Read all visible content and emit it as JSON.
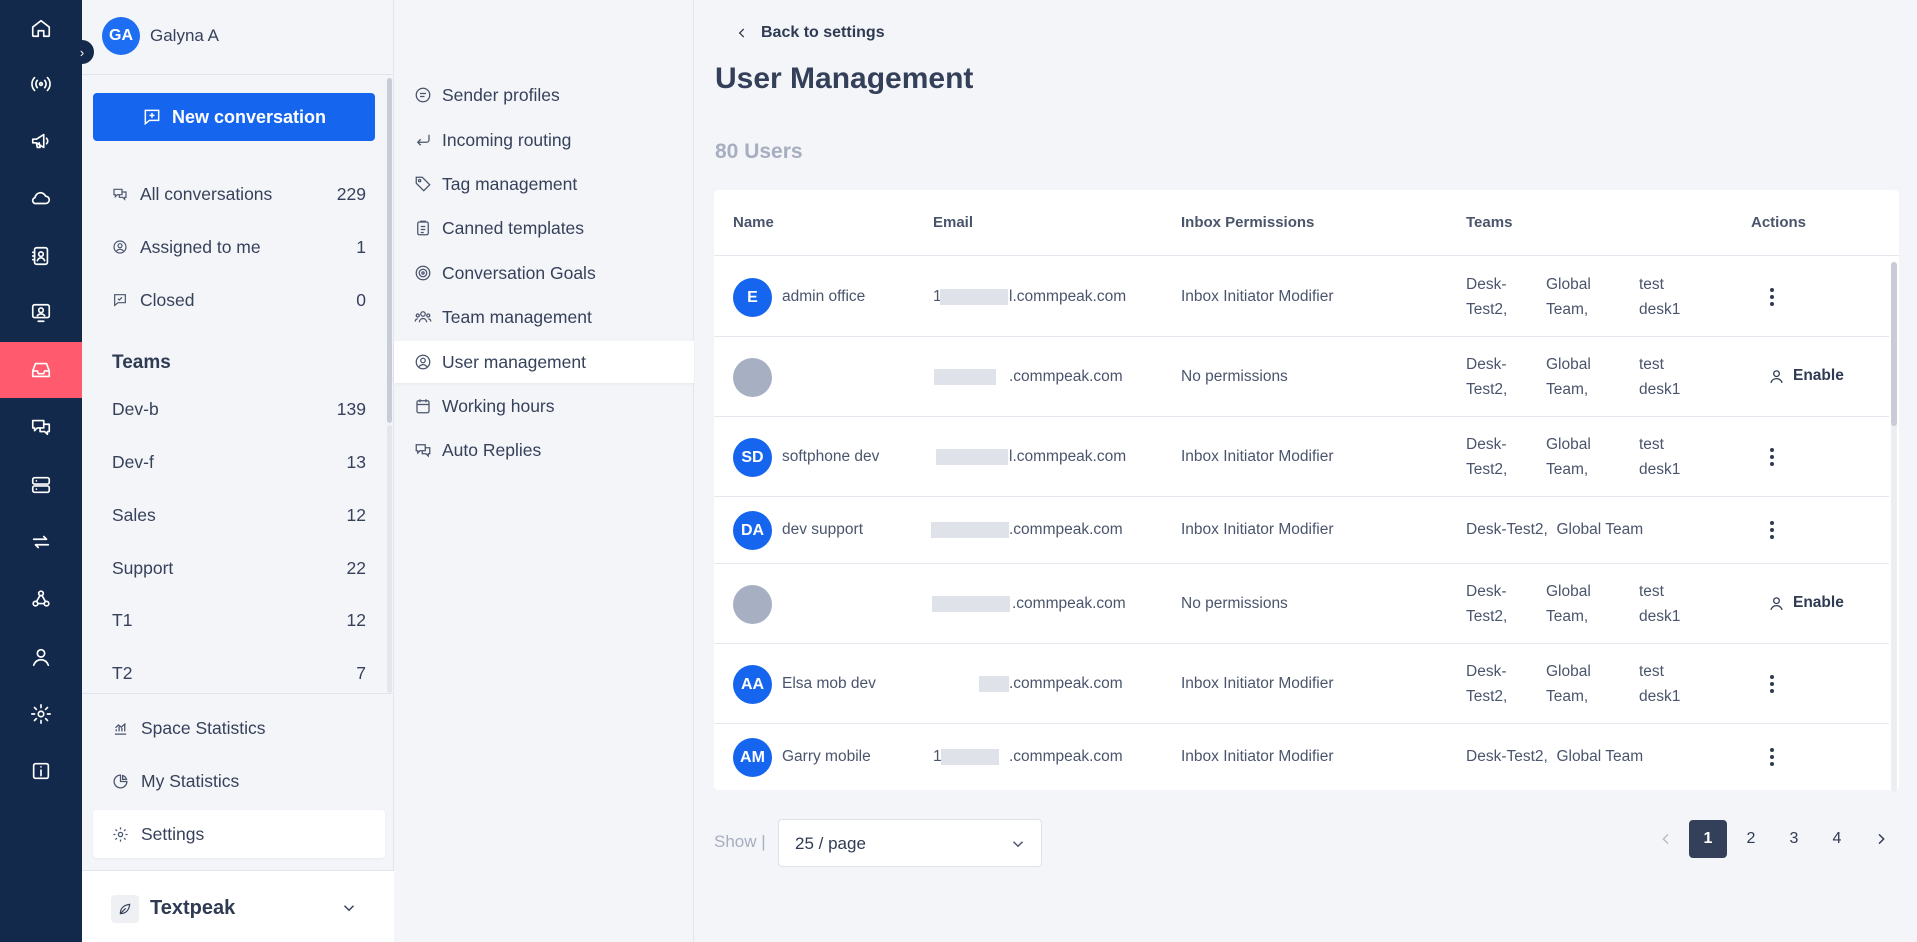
{
  "user": {
    "initials": "GA",
    "name": "Galyna A"
  },
  "sidebar": {
    "new_conversation_label": "New conversation",
    "nav": [
      {
        "label": "All conversations",
        "count": "229"
      },
      {
        "label": "Assigned to me",
        "count": "1"
      },
      {
        "label": "Closed",
        "count": "0"
      }
    ],
    "teams_title": "Teams",
    "teams": [
      {
        "label": "Dev-b",
        "count": "139"
      },
      {
        "label": "Dev-f",
        "count": "13"
      },
      {
        "label": "Sales",
        "count": "12"
      },
      {
        "label": "Support",
        "count": "22"
      },
      {
        "label": "T1",
        "count": "12"
      },
      {
        "label": "T2",
        "count": "7"
      }
    ],
    "bottom": [
      {
        "label": "Space Statistics"
      },
      {
        "label": "My Statistics"
      },
      {
        "label": "Settings"
      }
    ],
    "space_name": "Textpeak"
  },
  "settings_menu": [
    {
      "label": "Sender profiles"
    },
    {
      "label": "Incoming routing"
    },
    {
      "label": "Tag management"
    },
    {
      "label": "Canned templates"
    },
    {
      "label": "Conversation Goals"
    },
    {
      "label": "Team management"
    },
    {
      "label": "User management"
    },
    {
      "label": "Working hours"
    },
    {
      "label": "Auto Replies"
    }
  ],
  "main": {
    "back_label": "Back to settings",
    "title": "User Management",
    "user_count": "80 Users",
    "columns": [
      "Name",
      "Email",
      "Inbox Permissions",
      "Teams",
      "Actions"
    ],
    "rows": [
      {
        "initials": "E",
        "name": "admin office",
        "email_prefix": "1",
        "email_suffix": "l.commpeak.com",
        "permissions": "Inbox Initiator Modifier",
        "teams": [
          "Desk-",
          "Test2,",
          "Global",
          "Team,",
          "test",
          "desk1"
        ],
        "action": ""
      },
      {
        "initials": "",
        "name": "",
        "email_prefix": "",
        "email_suffix": ".commpeak.com",
        "permissions": "No permissions",
        "teams": [
          "Desk-",
          "Test2,",
          "Global",
          "Team,",
          "test",
          "desk1"
        ],
        "action": "Enable"
      },
      {
        "initials": "SD",
        "name": "softphone dev",
        "email_prefix": "",
        "email_suffix": "l.commpeak.com",
        "permissions": "Inbox Initiator Modifier",
        "teams": [
          "Desk-",
          "Test2,",
          "Global",
          "Team,",
          "test",
          "desk1"
        ],
        "action": ""
      },
      {
        "initials": "DA",
        "name": "dev support",
        "email_prefix": "",
        "email_suffix": ".commpeak.com",
        "permissions": "Inbox Initiator Modifier",
        "teams_inline": "Desk-Test2,  Global Team",
        "action": ""
      },
      {
        "initials": "",
        "name": "",
        "email_prefix": "",
        "email_suffix": ".commpeak.com",
        "permissions": "No permissions",
        "teams": [
          "Desk-",
          "Test2,",
          "Global",
          "Team,",
          "test",
          "desk1"
        ],
        "action": "Enable"
      },
      {
        "initials": "AA",
        "name": "Elsa mob dev",
        "email_prefix": "",
        "email_suffix": ".commpeak.com",
        "permissions": "Inbox Initiator Modifier",
        "teams": [
          "Desk-",
          "Test2,",
          "Global",
          "Team,",
          "test",
          "desk1"
        ],
        "action": ""
      },
      {
        "initials": "AM",
        "name": "Garry mobile",
        "email_prefix": "1",
        "email_suffix": ".commpeak.com",
        "permissions": "Inbox Initiator Modifier",
        "teams_inline": "Desk-Test2,  Global Team",
        "action": ""
      }
    ],
    "show_label": "Show |",
    "page_size": "25 / page",
    "pages": [
      "1",
      "2",
      "3",
      "4"
    ],
    "current_page": "1"
  },
  "colors": {
    "rail": "#13294b",
    "accent": "#1565ee",
    "rail_active": "#ff5a6e",
    "pager_active": "#34405a"
  }
}
